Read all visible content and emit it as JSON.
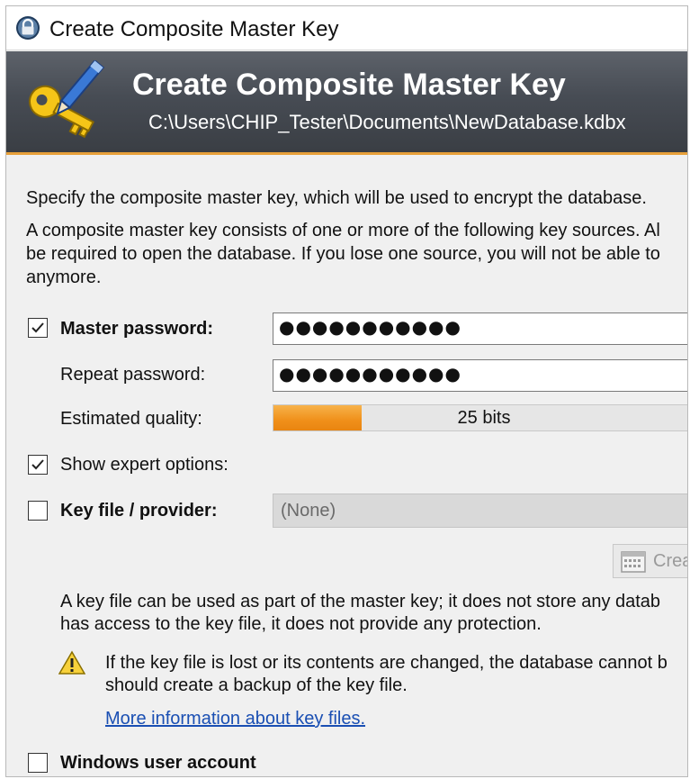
{
  "window": {
    "title": "Create Composite Master Key",
    "title_icon": "lock-icon"
  },
  "banner": {
    "title": "Create Composite Master Key",
    "path": "C:\\Users\\CHIP_Tester\\Documents\\NewDatabase.kdbx",
    "icon": "key-pen-icon"
  },
  "intro": {
    "line1": "Specify the composite master key, which will be used to encrypt the database.",
    "line2a": "A composite master key consists of one or more of the following key sources. Al",
    "line2b": "be required to open the database. If you lose one source, you will not be able to",
    "line2c": "anymore."
  },
  "master_password": {
    "label": "Master password:",
    "checked": true,
    "value": "●●●●●●●●●●●"
  },
  "repeat_password": {
    "label": "Repeat password:",
    "value": "●●●●●●●●●●●"
  },
  "quality": {
    "label": "Estimated quality:",
    "value_text": "25 bits",
    "fill_fraction": 0.21,
    "fill_color": "#f0901a"
  },
  "expert": {
    "label": "Show expert options:",
    "checked": true
  },
  "keyfile": {
    "label": "Key file / provider:",
    "checked": false,
    "selected": "(None)",
    "create_label": "Crea",
    "info1": "A key file can be used as part of the master key; it does not store any datab",
    "info2": "has access to the key file, it does not provide any protection.",
    "warn1": "If the key file is lost or its contents are changed, the database cannot b",
    "warn2": "should create a backup of the key file.",
    "warn_icon": "warning-icon",
    "link": "More information about key files."
  },
  "windows_account": {
    "label": "Windows user account",
    "checked": false
  }
}
